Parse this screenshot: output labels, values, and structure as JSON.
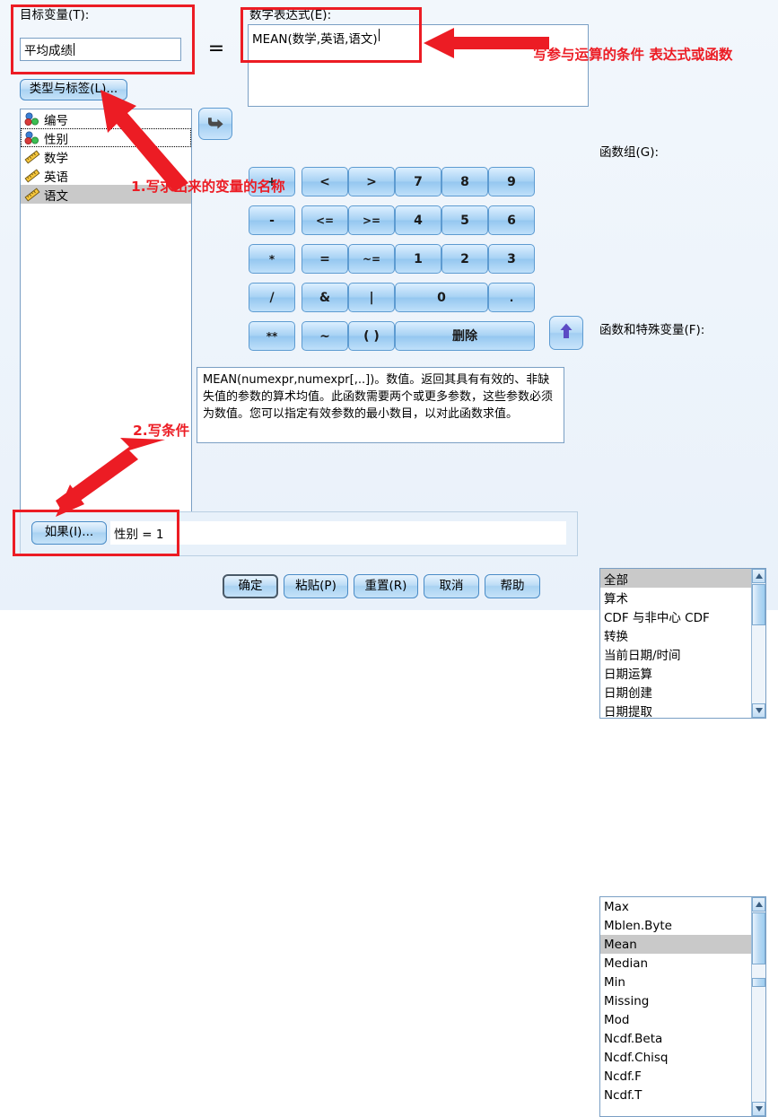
{
  "dialog": {
    "target_variable": {
      "label": "目标变量(T):",
      "value": "平均成绩",
      "type_label_button": "类型与标签(L)..."
    },
    "equals_sign": "=",
    "numeric_expression": {
      "label": "数字表达式(E):",
      "value": "MEAN(数学,英语,语文)"
    },
    "variables": [
      {
        "name": "编号",
        "icon": "nominal-icon"
      },
      {
        "name": "性别",
        "icon": "nominal-icon"
      },
      {
        "name": "数学",
        "icon": "scale-icon"
      },
      {
        "name": "英语",
        "icon": "scale-icon"
      },
      {
        "name": "语文",
        "icon": "scale-icon"
      }
    ],
    "move_button_icon": "arrow-right-icon",
    "up_button_icon": "arrow-up-icon",
    "keypad": [
      [
        "+",
        "<",
        ">",
        "7",
        "8",
        "9"
      ],
      [
        "-",
        "<=",
        ">=",
        "4",
        "5",
        "6"
      ],
      [
        "*",
        "=",
        "~=",
        "1",
        "2",
        "3"
      ],
      [
        "/",
        "&",
        "|",
        "0",
        "."
      ],
      [
        "**",
        "~",
        "( )",
        "删除"
      ]
    ],
    "function_help": "MEAN(numexpr,numexpr[,..])。数值。返回其具有有效的、非缺失值的参数的算术均值。此函数需要两个或更多参数，这些参数必须为数值。您可以指定有效参数的最小数目，以对此函数求值。",
    "function_group": {
      "label": "函数组(G):",
      "items": [
        "全部",
        "算术",
        "CDF 与非中心 CDF",
        "转换",
        "当前日期/时间",
        "日期运算",
        "日期创建",
        "日期提取"
      ],
      "selected": "全部"
    },
    "functions": {
      "label": "函数和特殊变量(F):",
      "items": [
        "Max",
        "Mblen.Byte",
        "Mean",
        "Median",
        "Min",
        "Missing",
        "Mod",
        "Ncdf.Beta",
        "Ncdf.Chisq",
        "Ncdf.F",
        "Ncdf.T"
      ],
      "selected": "Mean"
    },
    "condition": {
      "button": "如果(I)...",
      "value": "性别 = 1"
    },
    "buttons": {
      "ok": "确定",
      "paste": "粘贴(P)",
      "reset": "重置(R)",
      "cancel": "取消",
      "help": "帮助"
    }
  },
  "annotations": {
    "color": "#ec1c24",
    "note_expression": "写参与运算的条件 表达式或函数",
    "note_variable_name": "1.写求出来的变量的名称",
    "note_condition": "2.写条件"
  }
}
